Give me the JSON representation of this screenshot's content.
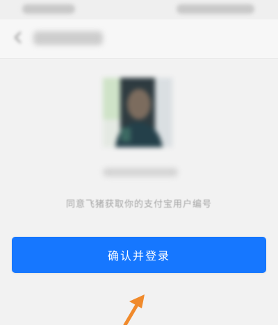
{
  "consent": {
    "text": "同意飞猪获取你的支付宝用户编号"
  },
  "confirm_button": {
    "label": "确认并登录"
  },
  "colors": {
    "background": "#f2f2f2",
    "primary_button": "#1677ff",
    "consent_text": "#a4a4a4",
    "annotation_arrow": "#f08a2c"
  },
  "icons": {
    "back": "back-arrow-icon",
    "annotation": "arrow-pointer-icon"
  }
}
